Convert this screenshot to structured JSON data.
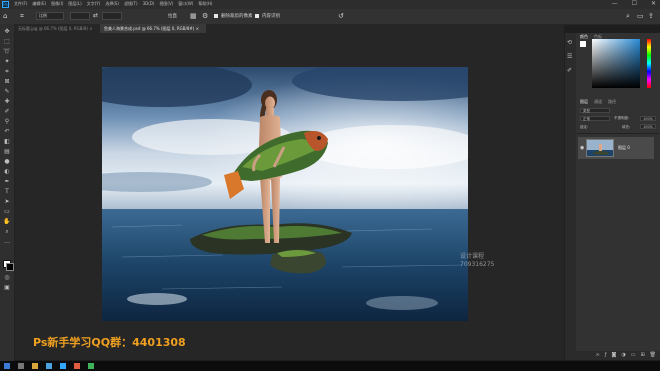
{
  "menubar": {
    "logo": "Ps",
    "items": [
      "文件(F)",
      "编辑(E)",
      "图像(I)",
      "图层(L)",
      "文字(Y)",
      "选择(S)",
      "滤镜(T)",
      "3D(D)",
      "视图(V)",
      "窗口(W)",
      "帮助(H)"
    ],
    "window_controls": [
      "—",
      "☐",
      "✕"
    ]
  },
  "options_bar": {
    "crop_ratio": "比例",
    "straighten": "拉直",
    "delete_cropped": "删除裁剪的像素",
    "content_aware": "内容识别"
  },
  "tabs": [
    {
      "label": "无标题.jpg @ 66.7% (图层 0, RGB/8) ×",
      "active": false
    },
    {
      "label": "鱼美人海景合成.psd @ 66.7% (图层 0, RGB/8#) ×",
      "active": true
    }
  ],
  "right_panel": {
    "color_tabs": [
      "颜色",
      "色板"
    ],
    "layer_tabs": [
      "图层",
      "通道",
      "路径"
    ],
    "kind_filter": "类型",
    "blend_mode": "正常",
    "opacity_label": "不透明度:",
    "opacity_value": "100%",
    "lock_label": "锁定:",
    "fill_label": "填充:",
    "fill_value": "100%",
    "layer_name": "图层 0"
  },
  "overlay": {
    "promo_text": "Ps新手学习QQ群：4401308",
    "watermark_line1": "设计课程",
    "watermark_line2": "709316275"
  },
  "colors": {
    "accent": "#31a8ff",
    "promo": "#f0a020"
  }
}
